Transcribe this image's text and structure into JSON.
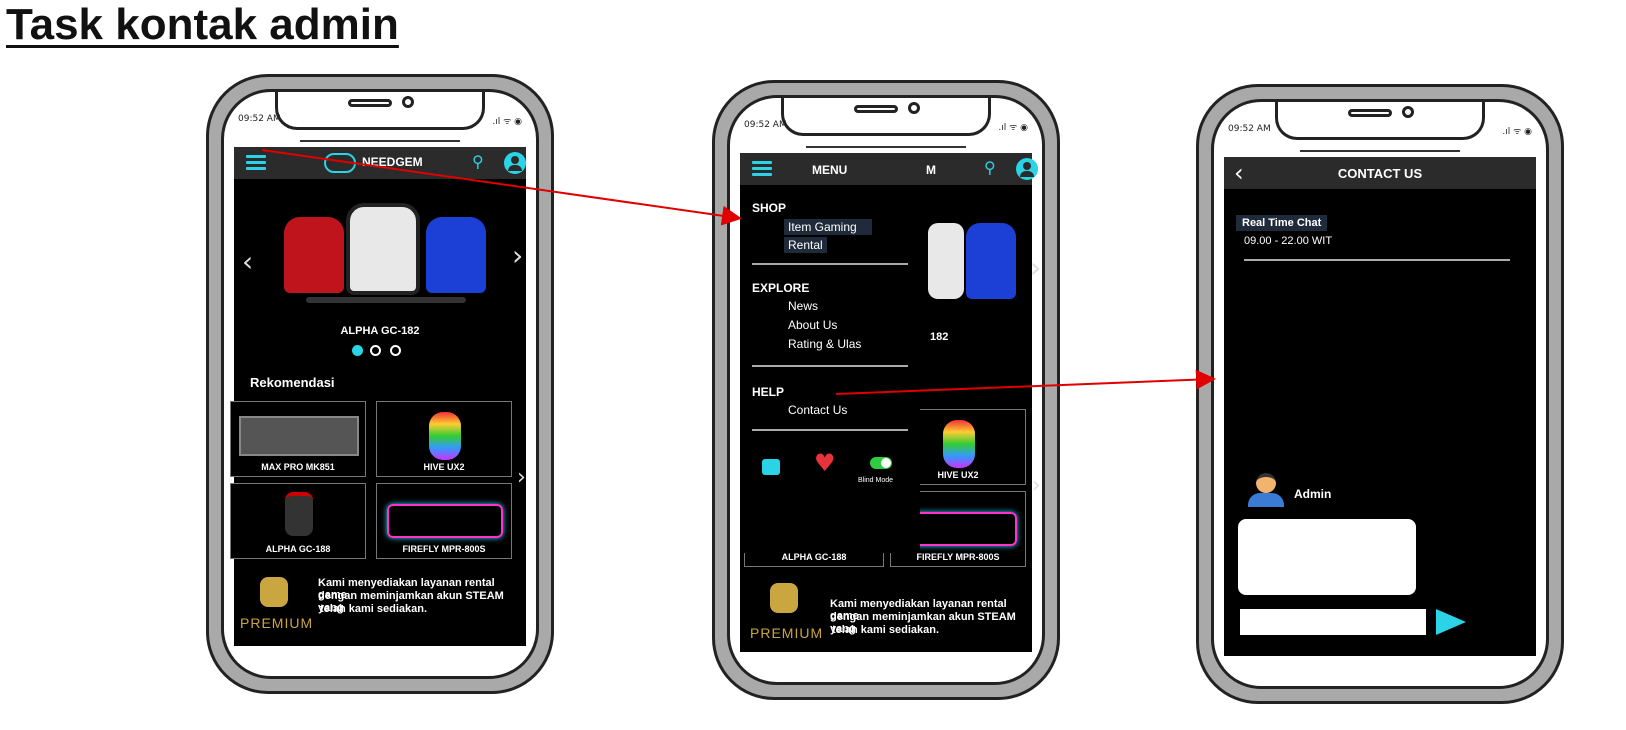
{
  "page_title": "Task kontak admin",
  "status_time": "09:52 AM",
  "phone1": {
    "brand": "NEEDGEM",
    "hero_product": "ALPHA GC-182",
    "section_title": "Rekomendasi",
    "products": [
      "MAX PRO MK851",
      "HIVE UX2",
      "ALPHA GC-188",
      "FIREFLY MPR-800S"
    ],
    "promo_text_1": "Kami menyediakan layanan rental game",
    "promo_text_2": "dengan meminjamkan akun STEAM yang",
    "promo_text_3": "telah kami sediakan.",
    "premium_label": "PREMIUM"
  },
  "phone2": {
    "menu_title": "MENU",
    "bg_title_fragment": "M",
    "bg_product_fragment": "182",
    "sections": [
      {
        "heading": "SHOP",
        "items": [
          "Item Gaming",
          "Rental"
        ]
      },
      {
        "heading": "EXPLORE",
        "items": [
          "News",
          "About Us",
          "Rating & Ulas"
        ]
      },
      {
        "heading": "HELP",
        "items": [
          "Contact Us"
        ]
      }
    ],
    "blind_mode_label": "Blind Mode",
    "bg_products": [
      "HIVE UX2",
      "FIREFLY MPR-800S",
      "ALPHA GC-188"
    ],
    "promo_text_1": "Kami menyediakan layanan rental game",
    "promo_text_2": "dengan meminjamkan akun STEAM yang",
    "promo_text_3": "telah kami sediakan.",
    "premium_label": "PREMIUM"
  },
  "phone3": {
    "header_title": "CONTACT US",
    "chat_title": "Real Time Chat",
    "chat_hours": "09.00 - 22.00 WIT",
    "admin_label": "Admin"
  },
  "colors": {
    "accent": "#2ad3e6",
    "arrow": "#e00000",
    "heart": "#e8323c"
  }
}
